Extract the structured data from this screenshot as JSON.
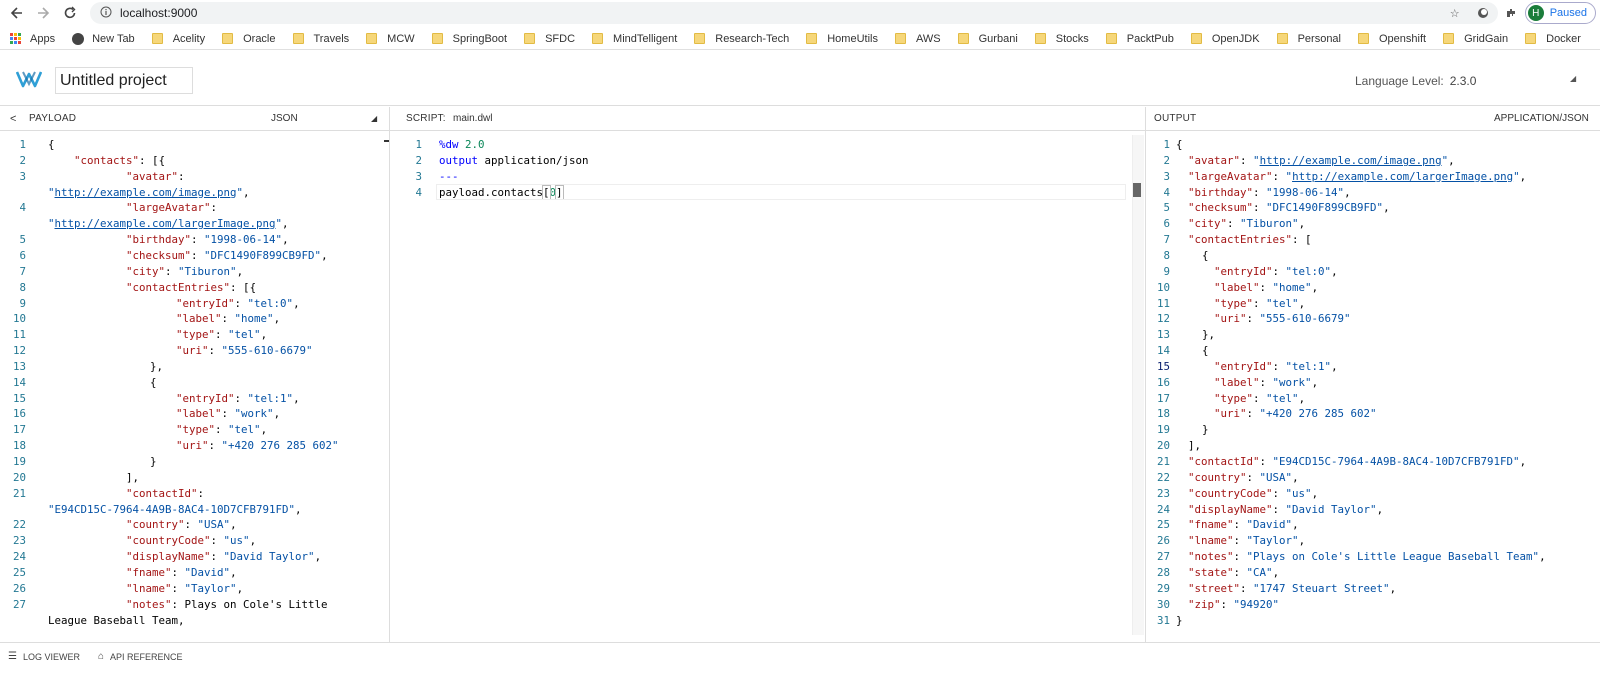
{
  "browser": {
    "url": "localhost:9000",
    "profile_initial": "H",
    "profile_status": "Paused"
  },
  "bookmarks": [
    "Apps",
    "New Tab",
    "Acelity",
    "Oracle",
    "Travels",
    "MCW",
    "SpringBoot",
    "SFDC",
    "MindTelligent",
    "Research-Tech",
    "HomeUtils",
    "AWS",
    "Gurbani",
    "Stocks",
    "PacktPub",
    "OpenJDK",
    "Personal",
    "Openshift",
    "GridGain",
    "Docker"
  ],
  "header": {
    "project_name": "Untitled project",
    "language_level_label": "Language Level:",
    "language_level_value": "2.3.0"
  },
  "payload": {
    "title": "PAYLOAD",
    "format": "JSON",
    "line_numbers": [
      "1",
      "2",
      "3",
      "",
      "4",
      "",
      "5",
      "6",
      "7",
      "8",
      "9",
      "10",
      "11",
      "12",
      "13",
      "14",
      "15",
      "16",
      "17",
      "18",
      "19",
      "20",
      "21",
      "",
      "22",
      "23",
      "24",
      "25",
      "26",
      "27",
      ""
    ],
    "lines": [
      "{",
      "\"contacts\": [{",
      "\"avatar\":",
      "\"http://example.com/image.png\",",
      "\"largeAvatar\":",
      "\"http://example.com/largerImage.png\",",
      "\"birthday\": \"1998-06-14\",",
      "\"checksum\": \"DFC1490F899CB9FD\",",
      "\"city\": \"Tiburon\",",
      "\"contactEntries\": [{",
      "\"entryId\": \"tel:0\",",
      "\"label\": \"home\",",
      "\"type\": \"tel\",",
      "\"uri\": \"555-610-6679\"",
      "},",
      "{",
      "\"entryId\": \"tel:1\",",
      "\"label\": \"work\",",
      "\"type\": \"tel\",",
      "\"uri\": \"+420 276 285 602\"",
      "}",
      "],",
      "\"contactId\":",
      "\"E94CD15C-7964-4A9B-8AC4-10D7CFB791FD\",",
      "\"country\": \"USA\",",
      "\"countryCode\": \"us\",",
      "\"displayName\": \"David Taylor\",",
      "\"fname\": \"David\",",
      "\"lname\": \"Taylor\",",
      "\"notes\": \"Plays on Cole's Little",
      "League Baseball Team\","
    ]
  },
  "script": {
    "title": "SCRIPT:",
    "filename": "main.dwl",
    "line_numbers": [
      "1",
      "2",
      "3",
      "4"
    ],
    "lines": [
      "%dw 2.0",
      "output application/json",
      "---",
      "payload.contacts[0]"
    ]
  },
  "output": {
    "title": "OUTPUT",
    "format": "APPLICATION/JSON",
    "line_numbers": [
      "1",
      "2",
      "3",
      "4",
      "5",
      "6",
      "7",
      "8",
      "9",
      "10",
      "11",
      "12",
      "13",
      "14",
      "15",
      "16",
      "17",
      "18",
      "19",
      "20",
      "21",
      "22",
      "23",
      "24",
      "25",
      "26",
      "27",
      "28",
      "29",
      "30",
      "31"
    ],
    "lines": [
      "{",
      "\"avatar\": \"http://example.com/image.png\",",
      "\"largeAvatar\": \"http://example.com/largerImage.png\",",
      "\"birthday\": \"1998-06-14\",",
      "\"checksum\": \"DFC1490F899CB9FD\",",
      "\"city\": \"Tiburon\",",
      "\"contactEntries\": [",
      "{",
      "\"entryId\": \"tel:0\",",
      "\"label\": \"home\",",
      "\"type\": \"tel\",",
      "\"uri\": \"555-610-6679\"",
      "},",
      "{",
      "\"entryId\": \"tel:1\",",
      "\"label\": \"work\",",
      "\"type\": \"tel\",",
      "\"uri\": \"+420 276 285 602\"",
      "}",
      "],",
      "\"contactId\": \"E94CD15C-7964-4A9B-8AC4-10D7CFB791FD\",",
      "\"country\": \"USA\",",
      "\"countryCode\": \"us\",",
      "\"displayName\": \"David Taylor\",",
      "\"fname\": \"David\",",
      "\"lname\": \"Taylor\",",
      "\"notes\": \"Plays on Cole's Little League Baseball Team\",",
      "\"state\": \"CA\",",
      "\"street\": \"1747 Steuart Street\",",
      "\"zip\": \"94920\"",
      "}"
    ]
  },
  "footer": {
    "log_viewer": "LOG VIEWER",
    "api_reference": "API REFERENCE"
  },
  "colors": {
    "key": "#a31515",
    "string": "#0451a5",
    "keyword": "#0000ff",
    "line_number": "#237893"
  }
}
